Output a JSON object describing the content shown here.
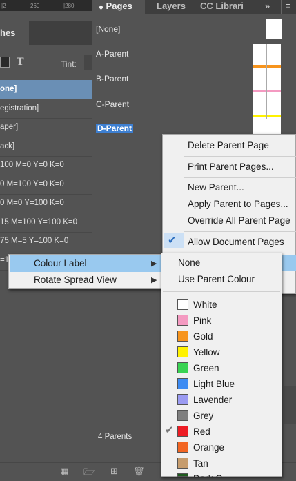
{
  "swatches_panel": {
    "ruler_ticks": [
      "|2",
      "260",
      "|280"
    ],
    "tab_label": "hes",
    "text_icon": "T",
    "tint_label": "Tint:",
    "rows": [
      {
        "label": "one]",
        "selected": true
      },
      {
        "label": "egistration]",
        "selected": false
      },
      {
        "label": "aper]",
        "selected": false
      },
      {
        "label": "ack]",
        "selected": false
      },
      {
        "label": "100 M=0 Y=0 K=0",
        "selected": false
      },
      {
        "label": "0 M=100 Y=0 K=0",
        "selected": false
      },
      {
        "label": "0 M=0 Y=100 K=0",
        "selected": false
      },
      {
        "label": "15 M=100 Y=100 K=0",
        "selected": false
      },
      {
        "label": "75 M=5 Y=100 K=0",
        "selected": false
      },
      {
        "label": "=1",
        "selected": false
      }
    ]
  },
  "pages_panel": {
    "tabs": [
      "Pages",
      "Layers",
      "CC Librari"
    ],
    "more_tabs": "»",
    "parents": [
      {
        "label": "[None]"
      },
      {
        "label": "A-Parent",
        "color": "#f7941d"
      },
      {
        "label": "B-Parent",
        "color": "#f49ac1"
      },
      {
        "label": "C-Parent",
        "color": "#fff200"
      },
      {
        "label": "D-Parent",
        "color": ""
      }
    ],
    "footer": "4 Parents"
  },
  "panel_menu": {
    "items": [
      "Delete Parent Page",
      "Print Parent Pages...",
      "New Parent...",
      "Apply Parent to Pages...",
      "Override All Parent Page",
      "Allow Document Pages"
    ],
    "checked_item": "Allow Document Pages"
  },
  "context_menu": {
    "items": [
      "Colour Label",
      "Rotate Spread View"
    ],
    "highlighted": "Colour Label"
  },
  "colour_submenu": {
    "top_items": [
      "None",
      "Use Parent Colour"
    ],
    "colors": [
      {
        "label": "White",
        "hex": "#ffffff",
        "checked": false
      },
      {
        "label": "Pink",
        "hex": "#f49ac1",
        "checked": false
      },
      {
        "label": "Gold",
        "hex": "#f7941d",
        "checked": false
      },
      {
        "label": "Yellow",
        "hex": "#fff200",
        "checked": false
      },
      {
        "label": "Green",
        "hex": "#39d353",
        "checked": false
      },
      {
        "label": "Light Blue",
        "hex": "#3d8bf2",
        "checked": false
      },
      {
        "label": "Lavender",
        "hex": "#9b9bf2",
        "checked": false
      },
      {
        "label": "Grey",
        "hex": "#7f7f7f",
        "checked": false
      },
      {
        "label": "Red",
        "hex": "#ed1c24",
        "checked": true
      },
      {
        "label": "Orange",
        "hex": "#f26522",
        "checked": false
      },
      {
        "label": "Tan",
        "hex": "#c69c6d",
        "checked": false
      },
      {
        "label": "Dark G",
        "hex": "#1e5c1e",
        "checked": false
      }
    ]
  }
}
